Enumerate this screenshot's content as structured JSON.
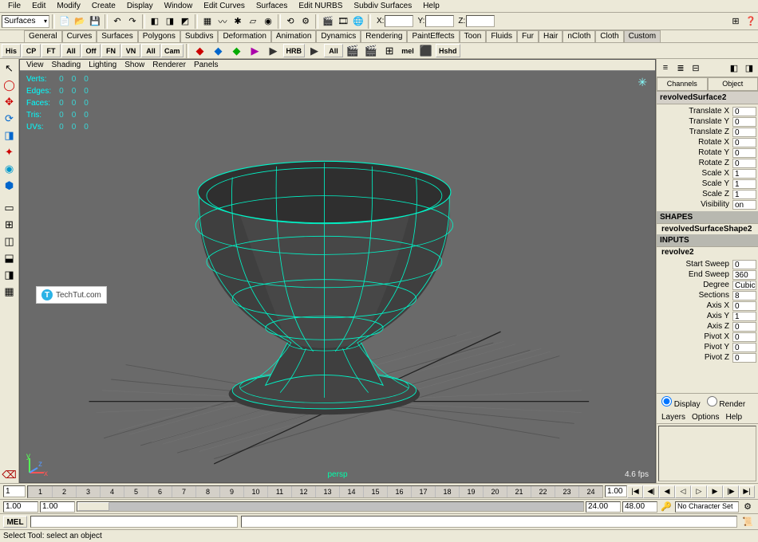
{
  "menu": [
    "File",
    "Edit",
    "Modify",
    "Create",
    "Display",
    "Window",
    "Edit Curves",
    "Surfaces",
    "Edit NURBS",
    "Subdiv Surfaces",
    "Help"
  ],
  "modeSelector": "Surfaces",
  "coord": {
    "x": "X:",
    "y": "Y:",
    "z": "Z:"
  },
  "shelfTabs": [
    "General",
    "Curves",
    "Surfaces",
    "Polygons",
    "Subdivs",
    "Deformation",
    "Animation",
    "Dynamics",
    "Rendering",
    "PaintEffects",
    "Toon",
    "Fluids",
    "Fur",
    "Hair",
    "nCloth",
    "Cloth",
    "Custom"
  ],
  "activeShelfTab": "Custom",
  "statusBtns": [
    "His",
    "CP",
    "FT",
    "All",
    "Off",
    "FN",
    "VN",
    "All",
    "Cam"
  ],
  "viewMenus": [
    "View",
    "Shading",
    "Lighting",
    "Show",
    "Renderer",
    "Panels"
  ],
  "hud": {
    "rows": [
      {
        "l": "Verts:",
        "a": "0",
        "b": "0",
        "c": "0"
      },
      {
        "l": "Edges:",
        "a": "0",
        "b": "0",
        "c": "0"
      },
      {
        "l": "Faces:",
        "a": "0",
        "b": "0",
        "c": "0"
      },
      {
        "l": "Tris:",
        "a": "0",
        "b": "0",
        "c": "0"
      },
      {
        "l": "UVs:",
        "a": "0",
        "b": "0",
        "c": "0"
      }
    ]
  },
  "perspLabel": "persp",
  "fpsLabel": "4.6 fps",
  "watermark": "TechTut.com",
  "channel": {
    "tabs": [
      "Channels",
      "Object"
    ],
    "nodeName": "revolvedSurface2",
    "transform": [
      {
        "l": "Translate X",
        "v": "0"
      },
      {
        "l": "Translate Y",
        "v": "0"
      },
      {
        "l": "Translate Z",
        "v": "0"
      },
      {
        "l": "Rotate X",
        "v": "0"
      },
      {
        "l": "Rotate Y",
        "v": "0"
      },
      {
        "l": "Rotate Z",
        "v": "0"
      },
      {
        "l": "Scale X",
        "v": "1"
      },
      {
        "l": "Scale Y",
        "v": "1"
      },
      {
        "l": "Scale Z",
        "v": "1"
      },
      {
        "l": "Visibility",
        "v": "on"
      }
    ],
    "shapesHdr": "SHAPES",
    "shapeNode": "revolvedSurfaceShape2",
    "inputsHdr": "INPUTS",
    "inputNode": "revolve2",
    "inputs": [
      {
        "l": "Start Sweep",
        "v": "0"
      },
      {
        "l": "End Sweep",
        "v": "360"
      },
      {
        "l": "Degree",
        "v": "Cubic"
      },
      {
        "l": "Sections",
        "v": "8"
      },
      {
        "l": "Axis X",
        "v": "0"
      },
      {
        "l": "Axis Y",
        "v": "1"
      },
      {
        "l": "Axis Z",
        "v": "0"
      },
      {
        "l": "Pivot X",
        "v": "0"
      },
      {
        "l": "Pivot Y",
        "v": "0"
      },
      {
        "l": "Pivot Z",
        "v": "0"
      }
    ]
  },
  "displayRender": {
    "display": "Display",
    "render": "Render"
  },
  "layerMenu": [
    "Layers",
    "Options",
    "Help"
  ],
  "time": {
    "cur": "1",
    "frames": [
      "1",
      "2",
      "3",
      "4",
      "5",
      "6",
      "7",
      "8",
      "9",
      "10",
      "11",
      "12",
      "13",
      "14",
      "15",
      "16",
      "17",
      "18",
      "19",
      "20",
      "21",
      "22",
      "23",
      "24"
    ],
    "end": "1.00"
  },
  "range": {
    "startA": "1.00",
    "startB": "1.00",
    "endA": "24.00",
    "endB": "48.00"
  },
  "charSet": "No Character Set",
  "cmdLabel": "MEL",
  "helpLine": "Select Tool: select an object"
}
